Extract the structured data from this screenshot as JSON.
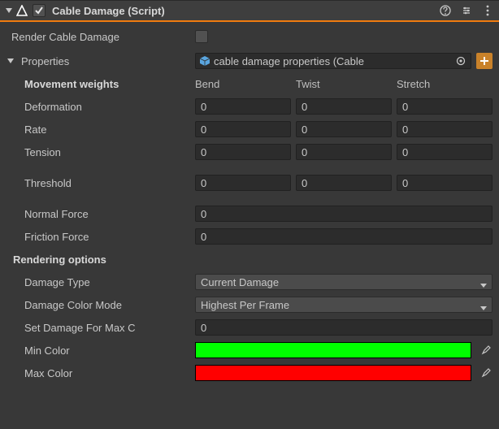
{
  "header": {
    "title": "Cable Damage (Script)",
    "enabled": true
  },
  "renderCableDamage": {
    "label": "Render Cable Damage",
    "checked": false
  },
  "propertiesSection": {
    "foldoutLabel": "Properties",
    "objectRef": "cable damage properties (Cable"
  },
  "movementWeights": {
    "label": "Movement weights",
    "cols": [
      "Bend",
      "Twist",
      "Stretch"
    ],
    "rows": {
      "deformation": {
        "label": "Deformation",
        "values": [
          "0",
          "0",
          "0"
        ]
      },
      "rate": {
        "label": "Rate",
        "values": [
          "0",
          "0",
          "0"
        ]
      },
      "tension": {
        "label": "Tension",
        "values": [
          "0",
          "0",
          "0"
        ]
      },
      "threshold": {
        "label": "Threshold",
        "values": [
          "0",
          "0",
          "0"
        ]
      }
    }
  },
  "forces": {
    "normal": {
      "label": "Normal Force",
      "value": "0"
    },
    "friction": {
      "label": "Friction Force",
      "value": "0"
    }
  },
  "rendering": {
    "section": "Rendering options",
    "damageType": {
      "label": "Damage Type",
      "value": "Current Damage"
    },
    "damageColorMode": {
      "label": "Damage Color Mode",
      "value": "Highest Per Frame"
    },
    "setDamageMax": {
      "label": "Set Damage For Max C",
      "value": "0"
    },
    "minColor": {
      "label": "Min Color",
      "hex": "#00ff00"
    },
    "maxColor": {
      "label": "Max Color",
      "hex": "#ff0000"
    }
  }
}
